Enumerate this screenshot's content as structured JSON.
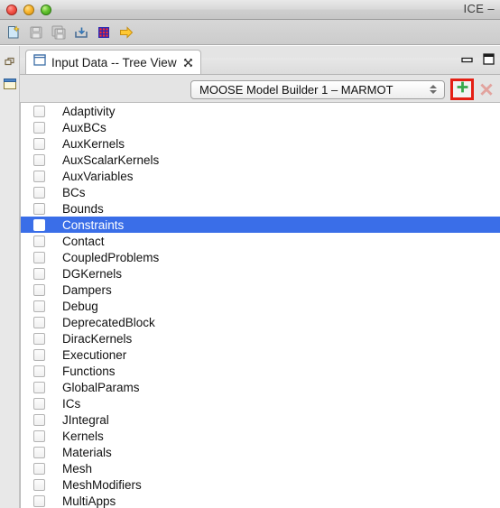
{
  "window": {
    "title": "ICE –",
    "lights": [
      "close",
      "minimize",
      "zoom"
    ]
  },
  "toolbar": {
    "items": [
      {
        "name": "new-file-icon",
        "label": "New"
      },
      {
        "name": "save-icon",
        "label": "Save"
      },
      {
        "name": "save-all-icon",
        "label": "Save All"
      },
      {
        "name": "import-icon",
        "label": "Import"
      },
      {
        "name": "grid-table-icon",
        "label": "Table"
      },
      {
        "name": "yellow-arrow-icon",
        "label": "Go"
      }
    ]
  },
  "leftbar": {
    "items": [
      {
        "name": "restore-perspective-icon",
        "label": "Restore"
      },
      {
        "name": "view-item-icon",
        "label": "View"
      }
    ]
  },
  "view": {
    "tab_label": "Input Data -- Tree View",
    "tab_close_label": "Close",
    "minimize_label": "Minimize",
    "maximize_label": "Maximize"
  },
  "combo": {
    "value": "MOOSE Model Builder 1 – MARMOT",
    "add_label": "+",
    "delete_label": "×"
  },
  "tree": {
    "rows": [
      {
        "label": "Adaptivity",
        "checked": false,
        "selected": false
      },
      {
        "label": "AuxBCs",
        "checked": false,
        "selected": false
      },
      {
        "label": "AuxKernels",
        "checked": false,
        "selected": false
      },
      {
        "label": "AuxScalarKernels",
        "checked": false,
        "selected": false
      },
      {
        "label": "AuxVariables",
        "checked": false,
        "selected": false
      },
      {
        "label": "BCs",
        "checked": false,
        "selected": false
      },
      {
        "label": "Bounds",
        "checked": false,
        "selected": false
      },
      {
        "label": "Constraints",
        "checked": false,
        "selected": true
      },
      {
        "label": "Contact",
        "checked": false,
        "selected": false
      },
      {
        "label": "CoupledProblems",
        "checked": false,
        "selected": false
      },
      {
        "label": "DGKernels",
        "checked": false,
        "selected": false
      },
      {
        "label": "Dampers",
        "checked": false,
        "selected": false
      },
      {
        "label": "Debug",
        "checked": false,
        "selected": false
      },
      {
        "label": "DeprecatedBlock",
        "checked": false,
        "selected": false
      },
      {
        "label": "DiracKernels",
        "checked": false,
        "selected": false
      },
      {
        "label": "Executioner",
        "checked": false,
        "selected": false
      },
      {
        "label": "Functions",
        "checked": false,
        "selected": false
      },
      {
        "label": "GlobalParams",
        "checked": false,
        "selected": false
      },
      {
        "label": "ICs",
        "checked": false,
        "selected": false
      },
      {
        "label": "JIntegral",
        "checked": false,
        "selected": false
      },
      {
        "label": "Kernels",
        "checked": false,
        "selected": false
      },
      {
        "label": "Materials",
        "checked": false,
        "selected": false
      },
      {
        "label": "Mesh",
        "checked": false,
        "selected": false
      },
      {
        "label": "MeshModifiers",
        "checked": false,
        "selected": false
      },
      {
        "label": "MultiApps",
        "checked": false,
        "selected": false
      }
    ]
  },
  "colors": {
    "selection": "#3a6ee8",
    "highlight_box": "#e41f14",
    "add_green": "#36a94b"
  }
}
